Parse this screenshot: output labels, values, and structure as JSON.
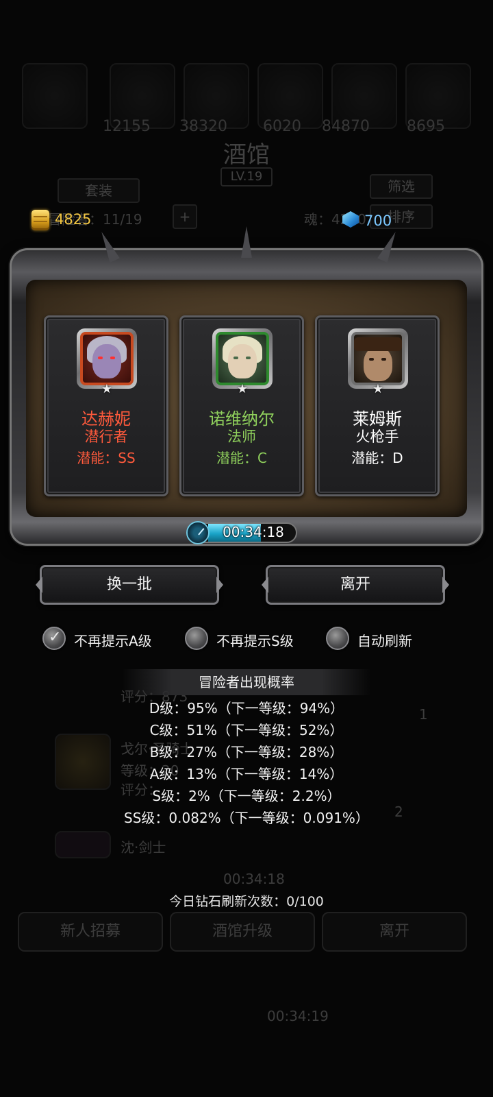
{
  "background": {
    "resource_counts": [
      "12155",
      "38320",
      "6020",
      "84870",
      "8695"
    ],
    "title": "酒馆",
    "level": "LV.19",
    "set_button": "套装",
    "filter_button": "筛选",
    "adventurer_count": "冒险者：11/19",
    "soul": "魂：4250",
    "sort_button": "排序",
    "list_name_1": "戈尔·圣骑士",
    "list_level": "等级：20",
    "list_score_1": "评分：873",
    "list_score_2": "评分：",
    "list_name_2": "沈·剑士",
    "timer": "00:34:18",
    "bottom_buttons": [
      "新人招募",
      "酒馆升级",
      "离开"
    ],
    "bottom_timer": "00:34:19",
    "side_badges": [
      "1",
      "2"
    ]
  },
  "currency": {
    "gold": "4825",
    "gems": "700"
  },
  "heroes": [
    {
      "name": "达赫妮",
      "class": "潜行者",
      "potential": "潜能：SS",
      "color": "#ff5a3c",
      "frame_color": "#c84a20",
      "stars": "★"
    },
    {
      "name": "诺维纳尔",
      "class": "法师",
      "potential": "潜能：C",
      "color": "#8fd05c",
      "frame_color": "#2e8a2e",
      "stars": "★"
    },
    {
      "name": "莱姆斯",
      "class": "火枪手",
      "potential": "潜能：D",
      "color": "#ffffff",
      "frame_color": "#6e6e6e",
      "stars": "★"
    }
  ],
  "timer": {
    "text": "00:34:18",
    "progress": 0.5
  },
  "buttons": {
    "refresh": "换一批",
    "leave": "离开"
  },
  "options": [
    {
      "label": "不再提示A级",
      "checked": true
    },
    {
      "label": "不再提示S级",
      "checked": false
    },
    {
      "label": "自动刷新",
      "checked": false
    }
  ],
  "probability": {
    "title": "冒险者出现概率",
    "lines": [
      "D级：95%（下一等级：94%）",
      "C级：51%（下一等级：52%）",
      "B级：27%（下一等级：28%）",
      "A级：13%（下一等级：14%）",
      "S级：2%（下一等级：2.2%）",
      "SS级：0.082%（下一等级：0.091%）"
    ]
  },
  "refresh_count": "今日钻石刷新次数：0/100"
}
